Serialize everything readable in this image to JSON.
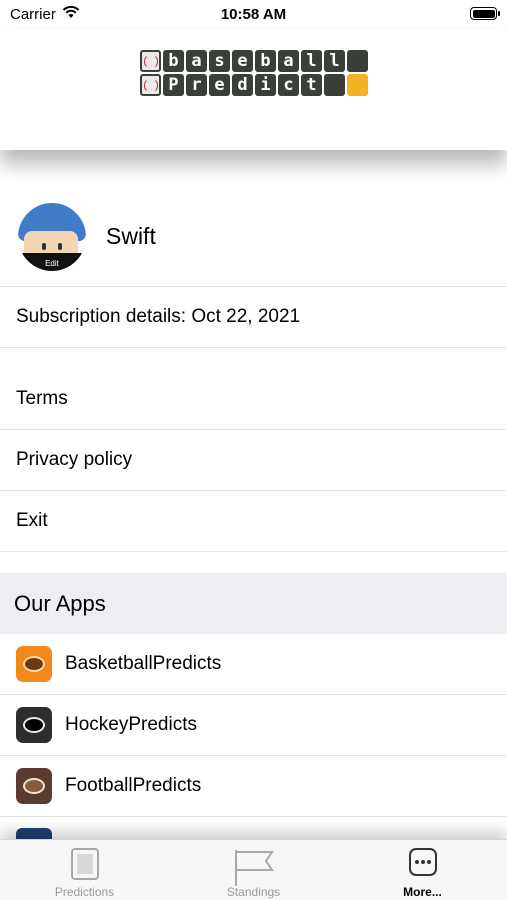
{
  "status_bar": {
    "carrier": "Carrier",
    "time": "10:58 AM"
  },
  "logo": {
    "row1": [
      "b",
      "a",
      "s",
      "e",
      "b",
      "a",
      "l",
      "l",
      ""
    ],
    "row2": [
      "P",
      "r",
      "e",
      "d",
      "i",
      "c",
      "t",
      ""
    ],
    "colors": {
      "tile": "#3a3f3a",
      "accent": "#f5b224"
    }
  },
  "profile": {
    "name": "Swift",
    "avatar_edit_label": "Edit"
  },
  "subscription": {
    "text": "Subscription details: Oct 22, 2021"
  },
  "menu": {
    "terms": "Terms",
    "privacy": "Privacy policy",
    "exit": "Exit"
  },
  "our_apps": {
    "title": "Our Apps",
    "apps": [
      {
        "name": "BasketballPredicts",
        "icon": "basketball-app-icon",
        "color": "#f08a1c"
      },
      {
        "name": "HockeyPredicts",
        "icon": "hockey-app-icon",
        "color": "#2b2e2c"
      },
      {
        "name": "FootballPredicts",
        "icon": "football-app-icon",
        "color": "#5a3b2e"
      }
    ]
  },
  "tab_bar": {
    "tabs": [
      {
        "label": "Predictions",
        "icon": "predictions-icon"
      },
      {
        "label": "Standings",
        "icon": "flag-icon"
      },
      {
        "label": "More...",
        "icon": "more-icon"
      }
    ],
    "active": "More..."
  }
}
